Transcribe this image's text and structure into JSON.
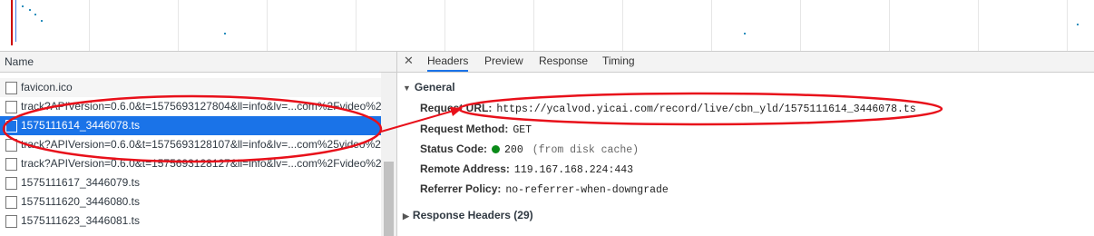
{
  "network": {
    "name_column": "Name"
  },
  "requests": [
    {
      "label": "favicon.ico",
      "state": "even"
    },
    {
      "label": "track?APIVersion=0.6.0&t=1575693127804&ll=info&lv=...com%2Fvideo%2",
      "state": ""
    },
    {
      "label": "1575111614_3446078.ts",
      "state": "selected"
    },
    {
      "label": "track?APIVersion=0.6.0&t=1575693128107&ll=info&lv=...com%25video%2",
      "state": ""
    },
    {
      "label": "track?APIVersion=0.6.0&t=1575693128127&ll=info&lv=...com%2Fvideo%2",
      "state": ""
    },
    {
      "label": "1575111617_3446079.ts",
      "state": ""
    },
    {
      "label": "1575111620_3446080.ts",
      "state": ""
    },
    {
      "label": "1575111623_3446081.ts",
      "state": ""
    }
  ],
  "tabs": {
    "close": "✕",
    "headers": "Headers",
    "preview": "Preview",
    "response": "Response",
    "timing": "Timing"
  },
  "general": {
    "title": "General",
    "request_url_key": "Request URL:",
    "request_url": "https://ycalvod.yicai.com/record/live/cbn_yld/1575111614_3446078.ts",
    "request_method_key": "Request Method:",
    "request_method": "GET",
    "status_code_key": "Status Code:",
    "status_code": "200",
    "status_note": "(from disk cache)",
    "remote_address_key": "Remote Address:",
    "remote_address": "119.167.168.224:443",
    "referrer_policy_key": "Referrer Policy:",
    "referrer_policy": "no-referrer-when-downgrade"
  },
  "response_headers": {
    "title": "Response Headers (29)"
  },
  "colors": {
    "selection": "#1a73e8",
    "annotation": "#e8101a",
    "status_ok": "#0a8a18"
  }
}
